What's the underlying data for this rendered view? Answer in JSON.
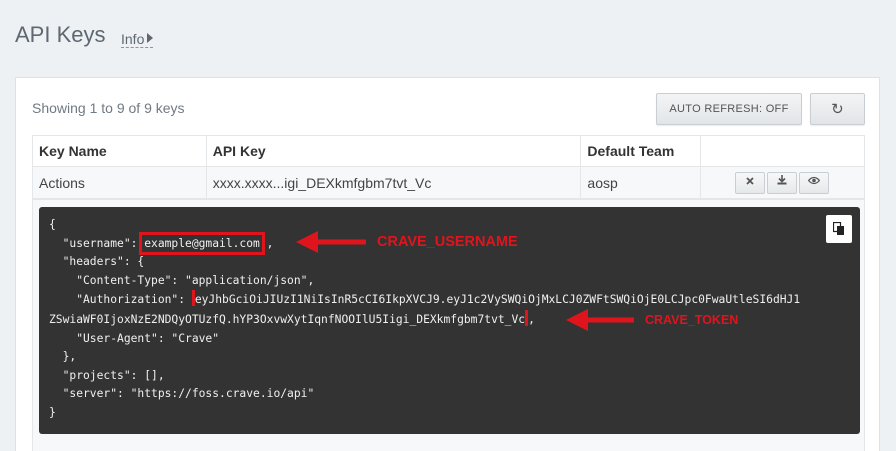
{
  "page": {
    "title": "API Keys",
    "info_label": "Info"
  },
  "toolbar": {
    "showing_text": "Showing 1 to 9 of 9 keys",
    "auto_refresh_label": "AUTO REFRESH: OFF",
    "reload_icon": "↻"
  },
  "table": {
    "headers": [
      "Key Name",
      "API Key",
      "Default Team",
      ""
    ],
    "rows": [
      {
        "name": "Actions",
        "key": "xxxx.xxxx...igi_DEXkmfgbm7tvt_Vc",
        "team": "aosp"
      }
    ]
  },
  "json_block": {
    "open": "{",
    "username_key": "  \"username\": ",
    "username_value": "example@gmail.com",
    "username_after": " ,",
    "headers_open": "  \"headers\": {",
    "content_type": "    \"Content-Type\": \"application/json\",",
    "auth_key": "    \"Authorization\": ",
    "auth_value_1": "eyJhbGciOiJIUzI1NiIsInR5cCI6IkpXVCJ9.eyJ1c2VySWQiOjMxLCJ0ZWFtSWQiOjE0LCJpc0FwaUtleSI6dHJ1",
    "auth_value_2": "ZSwiaWF0IjoxNzE2NDQyOTUzfQ.hYP3OxvwXytIqnfNOOIlU5Iigi_DEXkmfgbm7tvt_Vc",
    "auth_after": ",",
    "user_agent": "    \"User-Agent\": \"Crave\"",
    "headers_close": "  },",
    "projects": "  \"projects\": [],",
    "server": "  \"server\": \"https://foss.crave.io/api\"",
    "close": "}"
  },
  "annotations": {
    "username_label": "CRAVE_USERNAME",
    "token_label": "CRAVE_TOKEN",
    "color": "#e0141c"
  },
  "icons": {
    "delete": "close-icon",
    "download": "download-icon",
    "view": "eye-icon",
    "copy": "copy-icon",
    "reload": "refresh-icon"
  }
}
